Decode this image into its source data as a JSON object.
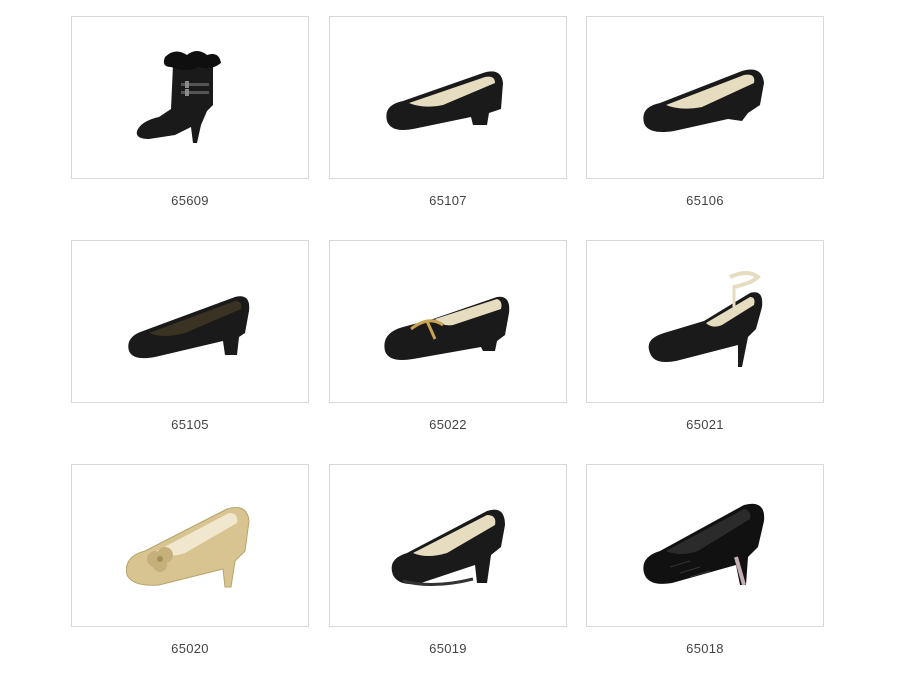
{
  "colors": {
    "card_border": "#d8d8d8",
    "code_text": "#444444",
    "leather_black": "#1a1a1a",
    "lining_cream": "#e6dcc0",
    "beige_leather": "#d8c491"
  },
  "products": [
    {
      "code": "65609",
      "icon": "ankle-boot-fur-icon"
    },
    {
      "code": "65107",
      "icon": "low-heel-pump-icon"
    },
    {
      "code": "65106",
      "icon": "wedge-heel-pump-icon"
    },
    {
      "code": "65105",
      "icon": "block-heel-pump-icon"
    },
    {
      "code": "65022",
      "icon": "buckle-loafer-icon"
    },
    {
      "code": "65021",
      "icon": "ankle-strap-heel-icon"
    },
    {
      "code": "65020",
      "icon": "beige-bow-pump-icon"
    },
    {
      "code": "65019",
      "icon": "high-heel-pump-icon"
    },
    {
      "code": "65018",
      "icon": "patterned-heel-pump-icon"
    }
  ]
}
